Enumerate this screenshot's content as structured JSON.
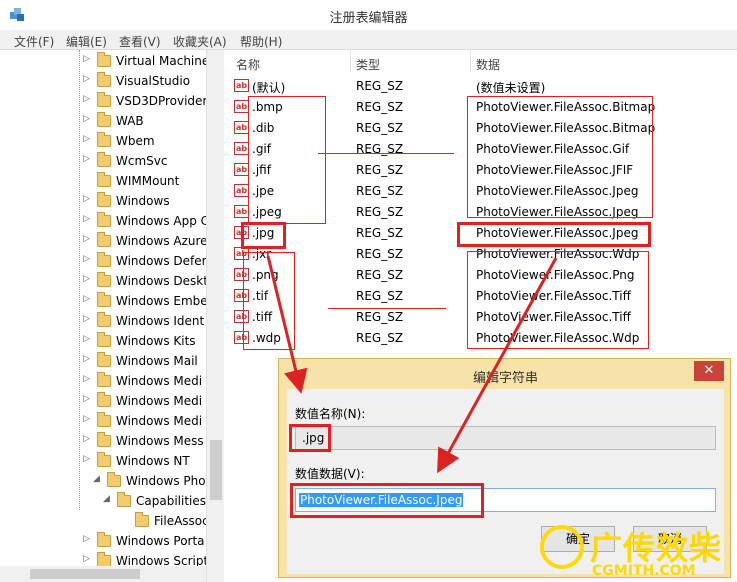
{
  "window": {
    "title": "注册表编辑器"
  },
  "menu": [
    "文件(F)",
    "编辑(E)",
    "查看(V)",
    "收藏夹(A)",
    "帮助(H)"
  ],
  "tree": [
    {
      "label": "Virtual Machine",
      "expander": "▷"
    },
    {
      "label": "VisualStudio",
      "expander": "▷"
    },
    {
      "label": "VSD3DProvider",
      "expander": "▷"
    },
    {
      "label": "WAB",
      "expander": "▷"
    },
    {
      "label": "Wbem",
      "expander": "▷"
    },
    {
      "label": "WcmSvc",
      "expander": "▷"
    },
    {
      "label": "WIMMount",
      "expander": ""
    },
    {
      "label": "Windows",
      "expander": "▷"
    },
    {
      "label": "Windows App C",
      "expander": "▷"
    },
    {
      "label": "Windows Azure",
      "expander": "▷"
    },
    {
      "label": "Windows Defer",
      "expander": "▷"
    },
    {
      "label": "Windows Deskt",
      "expander": "▷"
    },
    {
      "label": "Windows Embe",
      "expander": "▷"
    },
    {
      "label": "Windows Ident",
      "expander": "▷"
    },
    {
      "label": "Windows Kits",
      "expander": "▷"
    },
    {
      "label": "Windows Mail",
      "expander": "▷"
    },
    {
      "label": "Windows Medi",
      "expander": "▷"
    },
    {
      "label": "Windows Medi",
      "expander": "▷"
    },
    {
      "label": "Windows Medi",
      "expander": "▷"
    },
    {
      "label": "Windows Mess",
      "expander": "▷"
    },
    {
      "label": "Windows NT",
      "expander": "▷"
    },
    {
      "label": "Windows Photo",
      "expander": "◢"
    },
    {
      "label": "Capabilities",
      "expander": "◢"
    },
    {
      "label": "FileAssoc",
      "expander": ""
    },
    {
      "label": "Windows Porta",
      "expander": "▷"
    },
    {
      "label": "Windows Script",
      "expander": "▷"
    }
  ],
  "list": {
    "headers": {
      "name": "名称",
      "type": "类型",
      "data": "数据"
    },
    "icon_text": "ab",
    "rows": [
      {
        "name": "(默认)",
        "type": "REG_SZ",
        "data": "(数值未设置)"
      },
      {
        "name": ".bmp",
        "type": "REG_SZ",
        "data": "PhotoViewer.FileAssoc.Bitmap"
      },
      {
        "name": ".dib",
        "type": "REG_SZ",
        "data": "PhotoViewer.FileAssoc.Bitmap"
      },
      {
        "name": ".gif",
        "type": "REG_SZ",
        "data": "PhotoViewer.FileAssoc.Gif"
      },
      {
        "name": ".jfif",
        "type": "REG_SZ",
        "data": "PhotoViewer.FileAssoc.JFIF"
      },
      {
        "name": ".jpe",
        "type": "REG_SZ",
        "data": "PhotoViewer.FileAssoc.Jpeg"
      },
      {
        "name": ".jpeg",
        "type": "REG_SZ",
        "data": "PhotoViewer.FileAssoc.Jpeg"
      },
      {
        "name": ".jpg",
        "type": "REG_SZ",
        "data": "PhotoViewer.FileAssoc.Jpeg"
      },
      {
        "name": ".jxr",
        "type": "REG_SZ",
        "data": "PhotoViewer.FileAssoc.Wdp"
      },
      {
        "name": ".png",
        "type": "REG_SZ",
        "data": "PhotoViewer.FileAssoc.Png"
      },
      {
        "name": ".tif",
        "type": "REG_SZ",
        "data": "PhotoViewer.FileAssoc.Tiff"
      },
      {
        "name": ".tiff",
        "type": "REG_SZ",
        "data": "PhotoViewer.FileAssoc.Tiff"
      },
      {
        "name": ".wdp",
        "type": "REG_SZ",
        "data": "PhotoViewer.FileAssoc.Wdp"
      }
    ]
  },
  "dialog": {
    "title": "编辑字符串",
    "close": "✕",
    "value_name_label": "数值名称(N):",
    "value_name": ".jpg",
    "value_data_label": "数值数据(V):",
    "value_data": "PhotoViewer.FileAssoc.Jpeg",
    "ok": "确定",
    "cancel": "取消"
  },
  "watermark": {
    "text": "广传效柴",
    "url": "CGMITH.COM"
  },
  "colors": {
    "annotation": "#dd2222",
    "dialog_frame": "#f7e3a8",
    "selection": "#3399ff"
  }
}
